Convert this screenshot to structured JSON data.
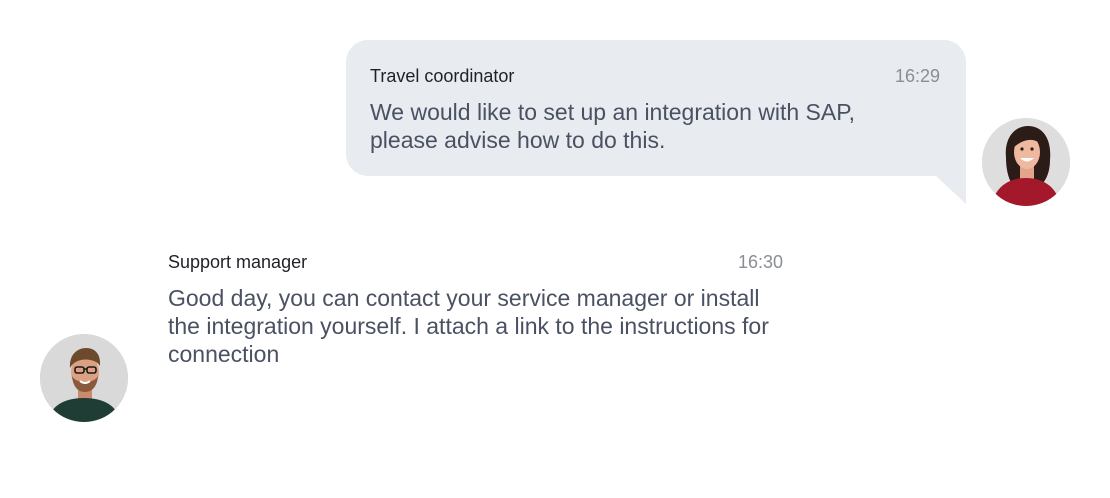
{
  "messages": {
    "outgoing": {
      "sender": "Travel coordinator",
      "time": "16:29",
      "text": "We would like to set up an integration with SAP, please advise how to do this.",
      "bubble_color": "#e8ebf0"
    },
    "incoming": {
      "sender": "Support manager",
      "time": "16:30",
      "text": "Good day, you can contact your service manager or install the integration yourself. I attach a link to the instructions for connection"
    }
  },
  "colors": {
    "sender": "#1f2128",
    "time": "#8a8d94",
    "body_text": "#4a5162"
  },
  "icons": {
    "outgoing_avatar": "woman-avatar",
    "incoming_avatar": "man-avatar"
  }
}
